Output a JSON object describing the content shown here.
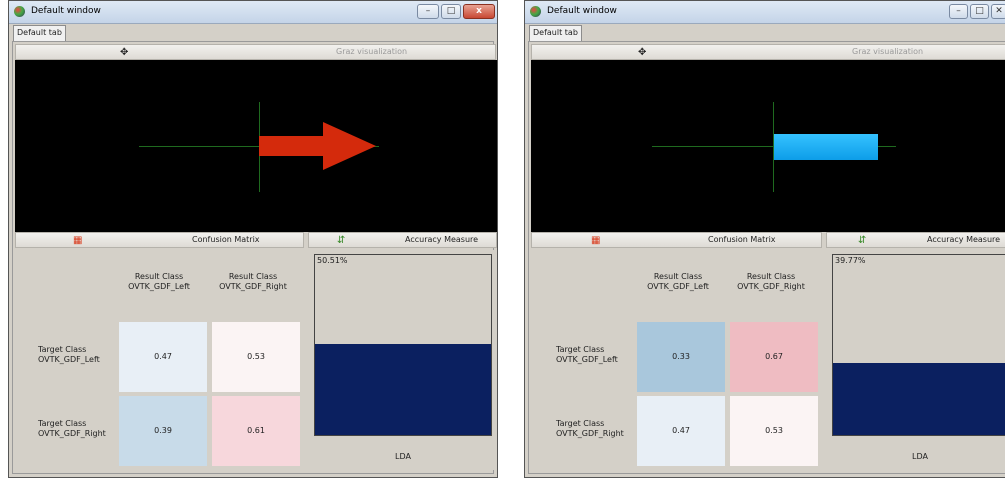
{
  "windows": [
    {
      "title": "Default window",
      "tab_label": "Default tab",
      "graz_label": "Graz visualization",
      "graz_icon": "move-icon",
      "feedback": "arrow-right",
      "feedback_color": "#d42a0c",
      "confusion_label": "Confusion Matrix",
      "accuracy_label": "Accuracy Measure",
      "columns": [
        "Result Class\nOVTK_GDF_Left",
        "Result Class\nOVTK_GDF_Right"
      ],
      "rows": [
        {
          "label": "Target Class\nOVTK_GDF_Left",
          "cells": [
            "0.47",
            "0.53"
          ]
        },
        {
          "label": "Target Class\nOVTK_GDF_Right",
          "cells": [
            "0.39",
            "0.61"
          ]
        }
      ],
      "cell_colors": [
        [
          "#e8eff6",
          "#fbf4f4"
        ],
        [
          "#c8dbe9",
          "#f7d7dc"
        ]
      ],
      "accuracy_text": "50.51%",
      "accuracy_value": 0.5051,
      "classifier": "LDA"
    },
    {
      "title": "Default window",
      "tab_label": "Default tab",
      "graz_label": "Graz visualization",
      "graz_icon": "move-icon",
      "feedback": "bar-right",
      "feedback_color": "#1ab2f4",
      "confusion_label": "Confusion Matrix",
      "accuracy_label": "Accuracy Measure",
      "columns": [
        "Result Class\nOVTK_GDF_Left",
        "Result Class\nOVTK_GDF_Right"
      ],
      "rows": [
        {
          "label": "Target Class\nOVTK_GDF_Left",
          "cells": [
            "0.33",
            "0.67"
          ]
        },
        {
          "label": "Target Class\nOVTK_GDF_Right",
          "cells": [
            "0.47",
            "0.53"
          ]
        }
      ],
      "cell_colors": [
        [
          "#a9c7dc",
          "#efbcc2"
        ],
        [
          "#e8eff6",
          "#fbf4f4"
        ]
      ],
      "accuracy_text": "39.77%",
      "accuracy_value": 0.3977,
      "classifier": "LDA"
    }
  ]
}
